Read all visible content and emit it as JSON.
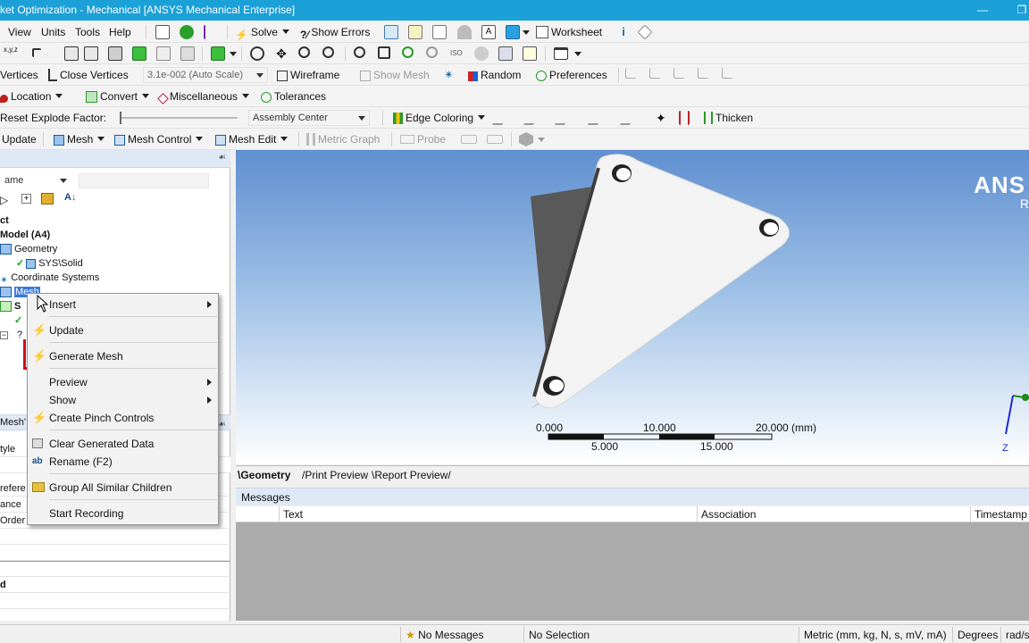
{
  "window": {
    "title": "ket Optimization - Mechanical [ANSYS Mechanical Enterprise]"
  },
  "menu": {
    "items": [
      "View",
      "Units",
      "Tools",
      "Help"
    ]
  },
  "toolbar1": {
    "solve": "Solve",
    "show_errors": "Show Errors",
    "worksheet": "Worksheet"
  },
  "toolbar3": {
    "vertices": "Vertices",
    "close_vertices": "Close Vertices",
    "scale": "3.1e-002 (Auto Scale)",
    "wireframe": "Wireframe",
    "show_mesh": "Show Mesh",
    "random": "Random",
    "preferences": "Preferences"
  },
  "toolbar4": {
    "location": "Location",
    "convert": "Convert",
    "miscellaneous": "Miscellaneous",
    "tolerances": "Tolerances"
  },
  "toolbar5": {
    "reset": "Reset",
    "explode_factor": "Explode Factor:",
    "assembly_center": "Assembly Center",
    "edge_coloring": "Edge Coloring",
    "thicken": "Thicken"
  },
  "toolbar6": {
    "update": "Update",
    "mesh": "Mesh",
    "mesh_control": "Mesh Control",
    "mesh_edit": "Mesh Edit",
    "metric_graph": "Metric Graph",
    "probe": "Probe"
  },
  "tree": {
    "filter_label": "ame",
    "project": "ct",
    "model": "Model (A4)",
    "geometry": "Geometry",
    "solid": "SYS\\Solid",
    "coord": "Coordinate Systems",
    "mesh": "Mesh",
    "s_item": "S",
    "q_item": "?"
  },
  "details": {
    "header": "Mesh'",
    "rows": [
      "tyle",
      "refere",
      "ance",
      "Order",
      "d"
    ]
  },
  "context_menu": {
    "items": [
      "Insert",
      "Update",
      "Generate Mesh",
      "Preview",
      "Show",
      "Create Pinch Controls",
      "Clear Generated Data",
      "Rename (F2)",
      "Group All Similar Children",
      "Start Recording"
    ]
  },
  "viewport": {
    "logo": "ANS",
    "logo_sub": "R",
    "scale_labels_top": [
      "0.000",
      "10.000",
      "20.000 (mm)"
    ],
    "scale_labels_bottom": [
      "5.000",
      "15.000"
    ],
    "axis_z": "Z"
  },
  "tabs": {
    "items": [
      "Geometry",
      "Print Preview",
      "Report Preview"
    ]
  },
  "messages": {
    "header": "Messages",
    "columns": [
      "Text",
      "Association",
      "Timestamp"
    ]
  },
  "status": {
    "messages": "No Messages",
    "selection": "No Selection",
    "units": "Metric (mm, kg, N, s, mV, mA)",
    "degrees": "Degrees",
    "rad": "rad/s"
  },
  "colors": {
    "title_bar": "#1ba0d8",
    "accent_green": "#1fa01f",
    "bolt_yellow": "#f2c400",
    "annotation_red": "#d0101a"
  }
}
